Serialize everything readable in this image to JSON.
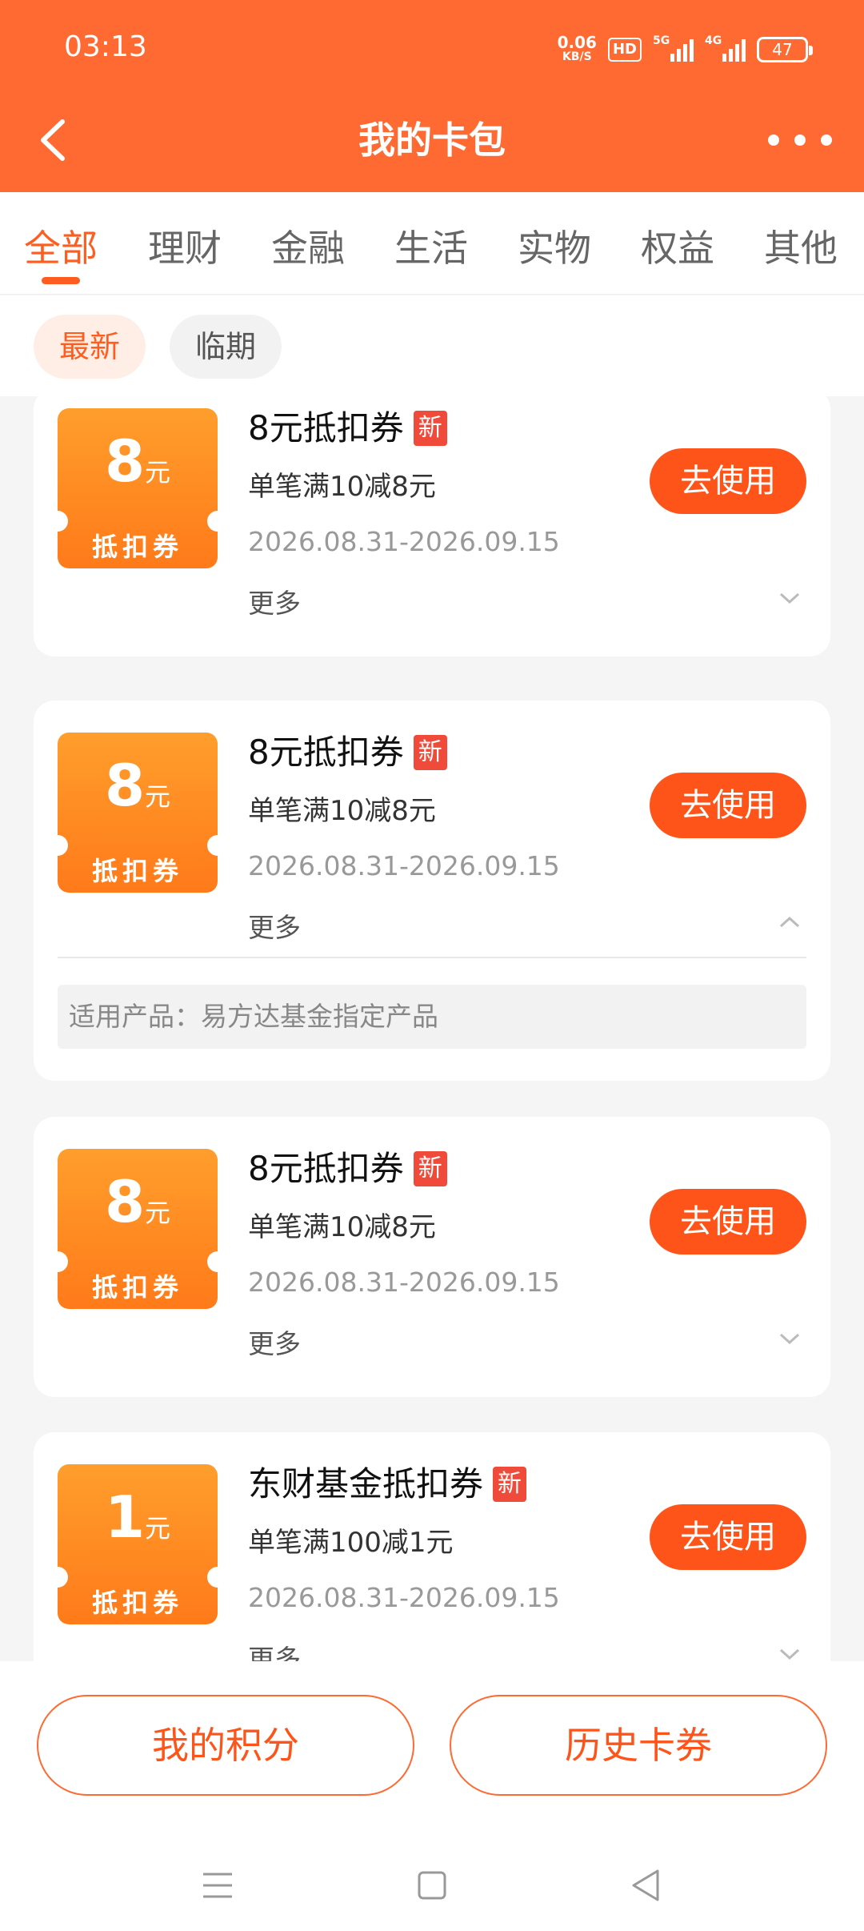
{
  "status_bar": {
    "time": "03:13",
    "net_speed": "0.06",
    "net_unit": "KB/S",
    "hd": "HD",
    "sim1": "5G",
    "sim2": "4G",
    "battery": "47"
  },
  "nav": {
    "title": "我的卡包"
  },
  "tabs": [
    {
      "label": "全部",
      "active": true
    },
    {
      "label": "理财",
      "active": false
    },
    {
      "label": "金融",
      "active": false
    },
    {
      "label": "生活",
      "active": false
    },
    {
      "label": "实物",
      "active": false
    },
    {
      "label": "权益",
      "active": false
    },
    {
      "label": "其他",
      "active": false
    }
  ],
  "filters": {
    "newest": "最新",
    "expiring": "临期"
  },
  "coupons": [
    {
      "amount": "8",
      "unit": "元",
      "type": "抵扣券",
      "title": "8元抵扣券",
      "badge": "新",
      "condition": "单笔满10减8元",
      "date": "2026.08.31-2026.09.15",
      "more": "更多",
      "button": "去使用"
    },
    {
      "amount": "8",
      "unit": "元",
      "type": "抵扣券",
      "title": "8元抵扣券",
      "badge": "新",
      "condition": "单笔满10减8元",
      "date": "2026.08.31-2026.09.15",
      "more": "更多",
      "button": "去使用",
      "expanded": true,
      "product": "适用产品：易方达基金指定产品"
    },
    {
      "amount": "8",
      "unit": "元",
      "type": "抵扣券",
      "title": "8元抵扣券",
      "badge": "新",
      "condition": "单笔满10减8元",
      "date": "2026.08.31-2026.09.15",
      "more": "更多",
      "button": "去使用"
    },
    {
      "amount": "1",
      "unit": "元",
      "type": "抵扣券",
      "title": "东财基金抵扣券",
      "badge": "新",
      "condition": "单笔满100减1元",
      "date": "2026.08.31-2026.09.15",
      "more": "更多",
      "button": "去使用"
    }
  ],
  "bottom": {
    "points": "我的积分",
    "history": "历史卡券"
  },
  "colors": {
    "brand": "#ff6a33",
    "accent": "#ff5419",
    "badge": "#f04a3a"
  }
}
